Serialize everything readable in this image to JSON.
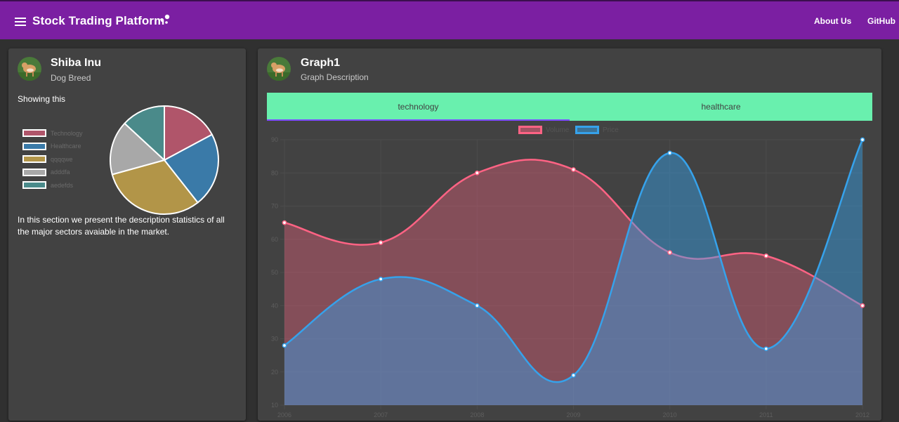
{
  "appbar": {
    "title": "Stock Trading Platform",
    "nav": [
      "About Us",
      "GitHub"
    ],
    "color": "#7b1fa2"
  },
  "left_card": {
    "title": "Shiba Inu",
    "subtitle": "Dog Breed",
    "showing": "Showing this",
    "description": "In this section we present the description statistics of all the major sectors avaiable in the market."
  },
  "right_card": {
    "title": "Graph1",
    "subtitle": "Graph Description",
    "tabs": [
      "technology",
      "healthcare"
    ],
    "active_tab": "technology"
  },
  "chart_data": [
    {
      "type": "pie",
      "labels": [
        "Technology",
        "Healthcare",
        "qqqqwe",
        "adddfa",
        "aedefds"
      ],
      "values": [
        17,
        22,
        31,
        16,
        13
      ],
      "colors": [
        "#b0556a",
        "#3a7aa8",
        "#b29548",
        "#a8a8a8",
        "#4a8a8a"
      ]
    },
    {
      "type": "area",
      "x": [
        2006,
        2007,
        2008,
        2009,
        2010,
        2011,
        2012
      ],
      "ylim": [
        10,
        90
      ],
      "yticks": [
        10,
        20,
        30,
        40,
        50,
        60,
        70,
        80,
        90
      ],
      "series": [
        {
          "name": "Volume",
          "values": [
            65,
            59,
            80,
            81,
            56,
            55,
            40
          ],
          "color": "#ff6384"
        },
        {
          "name": "Price",
          "values": [
            28,
            48,
            40,
            19,
            86,
            27,
            90
          ],
          "color": "#36a2eb"
        }
      ],
      "legend_position": "top"
    }
  ]
}
